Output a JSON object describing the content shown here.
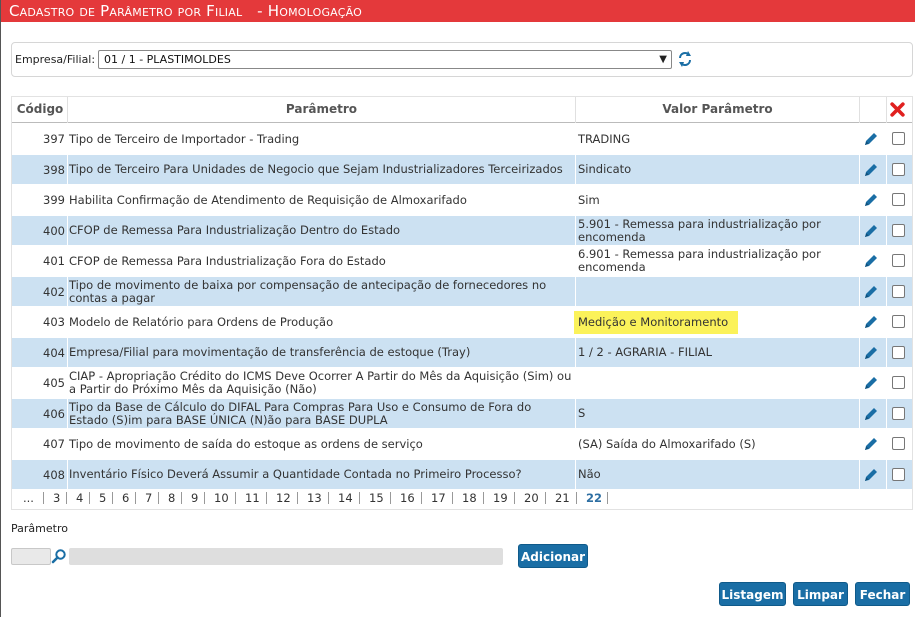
{
  "title": "Cadastro de Parâmetro por Filial   - Homologação",
  "filter": {
    "label": "Empresa/Filial:",
    "value": "01 / 1 - PLASTIMOLDES"
  },
  "grid": {
    "headers": {
      "codigo": "Código",
      "parametro": "Parâmetro",
      "valor": "Valor Parâmetro"
    },
    "rows": [
      {
        "codigo": "397",
        "parametro": "Tipo de Terceiro de Importador - Trading",
        "valor": "TRADING"
      },
      {
        "codigo": "398",
        "parametro": "Tipo de Terceiro Para Unidades de Negocio que Sejam Industrializadores Terceirizados",
        "valor": "Sindicato"
      },
      {
        "codigo": "399",
        "parametro": "Habilita Confirmação de Atendimento de Requisição de Almoxarifado",
        "valor": "Sim"
      },
      {
        "codigo": "400",
        "parametro": "CFOP de Remessa Para Industrialização Dentro do Estado",
        "valor": "5.901 - Remessa para industrialização por encomenda"
      },
      {
        "codigo": "401",
        "parametro": "CFOP de Remessa Para Industrialização Fora do Estado",
        "valor": "6.901 - Remessa para industrialização por encomenda"
      },
      {
        "codigo": "402",
        "parametro": "Tipo de movimento de baixa por compensação de antecipação de fornecedores no contas a pagar",
        "valor": ""
      },
      {
        "codigo": "403",
        "parametro": "Modelo de Relatório para Ordens de Produção",
        "valor": "Medição e Monitoramento"
      },
      {
        "codigo": "404",
        "parametro": "Empresa/Filial para movimentação de transferência de estoque (Tray)",
        "valor": "1 / 2 - AGRARIA - FILIAL"
      },
      {
        "codigo": "405",
        "parametro": "CIAP - Apropriação Crédito do ICMS Deve Ocorrer A Partir do Mês da Aquisição (Sim) ou a Partir do Próximo Mês da Aquisição (Não)",
        "valor": ""
      },
      {
        "codigo": "406",
        "parametro": "Tipo da Base de Cálculo do DIFAL Para Compras Para Uso e Consumo de Fora do Estado (S)im para BASE ÚNICA (N)ão para BASE DUPLA",
        "valor": "S"
      },
      {
        "codigo": "407",
        "parametro": "Tipo de movimento de saída do estoque as ordens de serviço",
        "valor": "(SA) Saída do Almoxarifado (S)"
      },
      {
        "codigo": "408",
        "parametro": "Inventário Físico Deverá Assumir a Quantidade Contada no Primeiro Processo?",
        "valor": "Não"
      }
    ]
  },
  "pager": {
    "pages": [
      "...",
      "3",
      "4",
      "5",
      "6",
      "7",
      "8",
      "9",
      "10",
      "11",
      "12",
      "13",
      "14",
      "15",
      "16",
      "17",
      "18",
      "19",
      "20",
      "21",
      "22"
    ],
    "current": "22"
  },
  "param": {
    "label": "Parâmetro"
  },
  "buttons": {
    "add": "Adicionar",
    "list": "Listagem",
    "clear": "Limpar",
    "close": "Fechar"
  },
  "colors": {
    "title_bg": "#e4393b",
    "row_alt": "#cce1f2",
    "button": "#1a6ea5",
    "highlight": "#fbf25a",
    "delete_icon": "#e0201f",
    "edit_icon": "#1a6ea5"
  }
}
